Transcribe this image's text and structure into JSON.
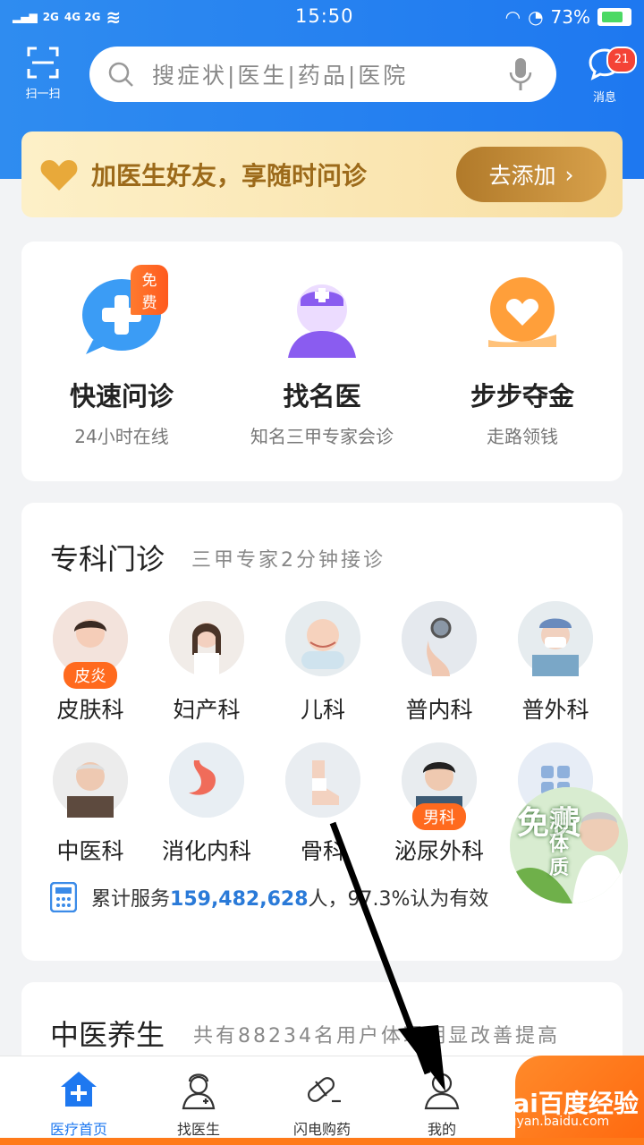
{
  "status": {
    "signal1": "2G",
    "signal2": "4G 2G",
    "time": "15:50",
    "battery": "73%"
  },
  "header": {
    "scan_label": "扫一扫",
    "search_placeholder": "搜症状|医生|药品|医院",
    "msg_label": "消息",
    "msg_badge": "21"
  },
  "banner": {
    "text": "加医生好友，享随时问诊",
    "button": "去添加"
  },
  "features": [
    {
      "title": "快速问诊",
      "sub": "24小时在线",
      "badge": "免费"
    },
    {
      "title": "找名医",
      "sub": "知名三甲专家会诊"
    },
    {
      "title": "步步夺金",
      "sub": "走路领钱"
    }
  ],
  "specialty": {
    "title": "专科门诊",
    "subtitle": "三甲专家2分钟接诊",
    "row1": [
      {
        "name": "皮肤科",
        "tag": "皮炎"
      },
      {
        "name": "妇产科"
      },
      {
        "name": "儿科"
      },
      {
        "name": "普内科"
      },
      {
        "name": "普外科"
      }
    ],
    "row2": [
      {
        "name": "中医科"
      },
      {
        "name": "消化内科"
      },
      {
        "name": "骨科"
      },
      {
        "name": "泌尿外科",
        "tag": "男科"
      }
    ],
    "stats_prefix": "累计服务",
    "stats_num": "159,482,628",
    "stats_suffix": "人，97.3%认为有效"
  },
  "promo": {
    "text1": "免费",
    "text2": "测体质"
  },
  "tcm": {
    "title": "中医养生",
    "subtitle": "共有88234名用户体现明显改善提高"
  },
  "tabs": [
    {
      "label": "医疗首页"
    },
    {
      "label": "找医生"
    },
    {
      "label": "闪电购药"
    },
    {
      "label": "我的"
    }
  ],
  "watermark": {
    "brand": "Bai百度经验",
    "url": "jingyan.baidu.com"
  }
}
